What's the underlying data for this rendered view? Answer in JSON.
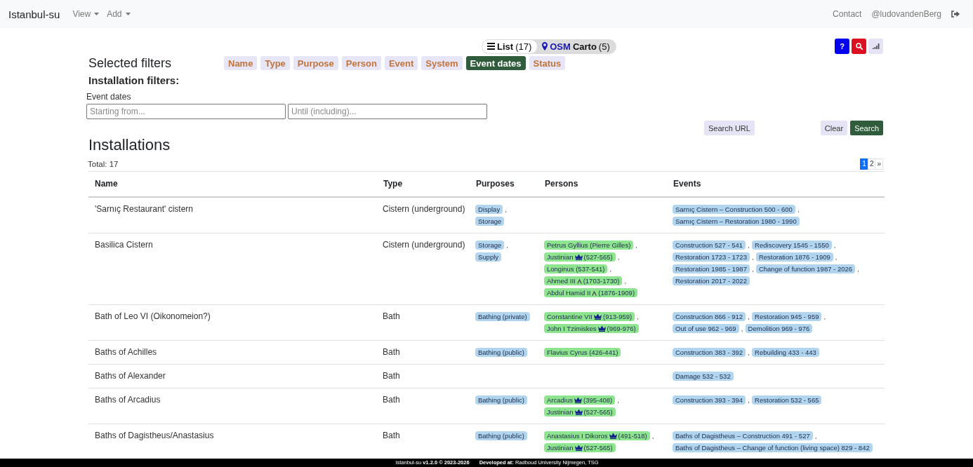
{
  "navbar": {
    "brand": "Istanbul-su",
    "menus": [
      {
        "label": "View"
      },
      {
        "label": "Add"
      }
    ],
    "links": [
      "Contact",
      "@ludovandenBerg"
    ]
  },
  "view_toggle": [
    {
      "kind": "list",
      "label": "List",
      "count": "(17)",
      "selected": true
    },
    {
      "kind": "map",
      "prefix": "OSM",
      "label": "Carto",
      "count": "(5)",
      "selected": false
    }
  ],
  "tool_buttons": [
    {
      "kind": "help",
      "label": "?"
    },
    {
      "kind": "search"
    },
    {
      "kind": "signal"
    }
  ],
  "filters": {
    "title": "Selected filters",
    "tags": [
      {
        "label": "Name",
        "selected": false
      },
      {
        "label": "Type",
        "selected": false
      },
      {
        "label": "Purpose",
        "selected": false
      },
      {
        "label": "Person",
        "selected": false
      },
      {
        "label": "Event",
        "selected": false
      },
      {
        "label": "System",
        "selected": false
      },
      {
        "label": "Event dates",
        "selected": true
      },
      {
        "label": "Status",
        "selected": false
      }
    ],
    "subtitle": "Installation filters:",
    "field_label": "Event dates",
    "inputs": [
      {
        "placeholder": "Starting from..."
      },
      {
        "placeholder": "Until (including)..."
      }
    ],
    "buttons": [
      {
        "kind": "url",
        "label": "Search URL"
      },
      {
        "kind": "clear",
        "label": "Clear"
      },
      {
        "kind": "search",
        "label": "Search"
      }
    ]
  },
  "installations": {
    "title": "Installations",
    "total": "Total: 17",
    "pages": [
      {
        "label": "1",
        "selected": true
      },
      {
        "label": "2",
        "selected": false
      }
    ],
    "next": "»",
    "separator": ",",
    "columns": [
      "Name",
      "Type",
      "Purposes",
      "Persons",
      "Events"
    ],
    "rows": [
      {
        "name": "'Sarnıç Restaurant' cistern",
        "type": "Cistern (underground)",
        "purposes": [
          "Display",
          "Storage"
        ],
        "events": [
          "Sarnıç Cistern – Construction 500 - 600",
          "Sarnıç Cistern – Restoration 1980 - 1990"
        ]
      },
      {
        "name": "Basilica Cistern",
        "type": "Cistern (underground)",
        "purposes": [
          "Storage",
          "Supply"
        ],
        "persons": [
          {
            "kind": "plain",
            "name": "Petrus Gyllius (Pierre Gilles)"
          },
          {
            "kind": "crown",
            "name": "Justinian",
            "dates": "(527-565)"
          },
          {
            "kind": "plain",
            "name": "Longinus",
            "dates": "(537-541)"
          },
          {
            "kind": "chevron",
            "name": "Ahmed III",
            "dates": "(1703-1730)"
          },
          {
            "kind": "chevron",
            "name": "Abdul Hamid II",
            "dates": "(1876-1909)"
          }
        ],
        "events": [
          "Construction 527 - 541",
          "Rediscovery 1545 - 1550",
          "Restoration 1723 - 1723",
          "Restoration 1876 - 1909",
          "Restoration 1985 - 1987",
          "Change of function 1987 - 2026",
          "Restoration 2017 - 2022"
        ]
      },
      {
        "name": "Bath of Leo VI (Oikonomeion?)",
        "type": "Bath",
        "purposes": [
          "Bathing (private)"
        ],
        "persons": [
          {
            "kind": "crown",
            "name": "Constantine VII",
            "dates": "(913-959)"
          },
          {
            "kind": "crown",
            "name": "John I Tzimiskes",
            "dates": "(969-976)"
          }
        ],
        "events": [
          "Construction 866 - 912",
          "Restoration 945 - 959",
          "Out of use 962 - 969",
          "Demolition 969 - 976"
        ]
      },
      {
        "name": "Baths of Achilles",
        "type": "Bath",
        "purposes": [
          "Bathing (public)"
        ],
        "persons": [
          {
            "kind": "plain",
            "name": "Flavius Cyrus",
            "dates": "(426-441)"
          }
        ],
        "events": [
          "Construction 383 - 392",
          "Rebuilding 433 - 443"
        ]
      },
      {
        "name": "Baths of Alexander",
        "type": "Bath",
        "events": [
          "Damage 532 - 532"
        ]
      },
      {
        "name": "Baths of Arcadius",
        "type": "Bath",
        "purposes": [
          "Bathing (public)"
        ],
        "persons": [
          {
            "kind": "crown",
            "name": "Arcadius",
            "dates": "(395-408)"
          },
          {
            "kind": "crown",
            "name": "Justinian",
            "dates": "(527-565)"
          }
        ],
        "events": [
          "Construction 393 - 394",
          "Restoration 532 - 565"
        ]
      },
      {
        "name": "Baths of Dagistheus/Anastasius",
        "type": "Bath",
        "purposes": [
          "Bathing (public)"
        ],
        "persons": [
          {
            "kind": "crown",
            "name": "Anastasius I Dikoros",
            "dates": "(491-518)"
          },
          {
            "kind": "crown",
            "name": "Justinian",
            "dates": "(527-565)"
          }
        ],
        "events": [
          "Baths of Dagistheus – Construction 491 - 527",
          "Baths of Dagistheus – Change of function (living space) 829 - 842"
        ]
      }
    ]
  },
  "footer": {
    "version": "Istanbul-su **v1.2.0 © 2023-2026**",
    "credit": "**Developed at:** Radboud University Nijmegen, TSG"
  }
}
